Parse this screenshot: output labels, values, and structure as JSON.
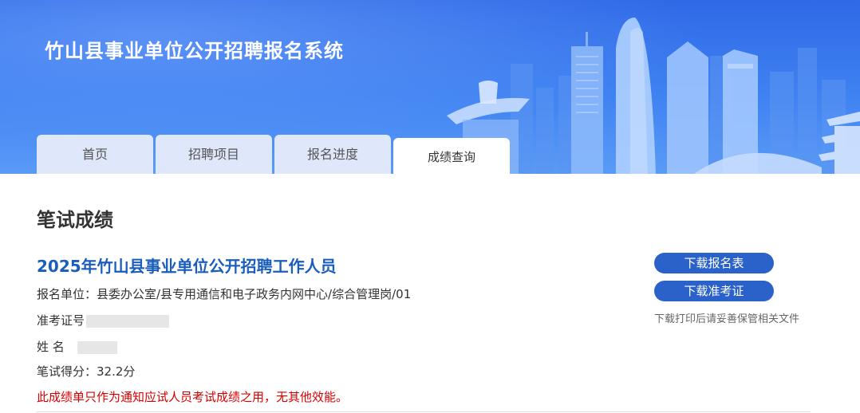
{
  "header": {
    "title": "竹山县事业单位公开招聘报名系统"
  },
  "tabs": [
    {
      "label": "首页"
    },
    {
      "label": "招聘项目"
    },
    {
      "label": "报名进度"
    },
    {
      "label": "成绩查询",
      "active": true
    }
  ],
  "main": {
    "section_title": "笔试成绩",
    "exam_title": "2025年竹山县事业单位公开招聘工作人员",
    "unit": "报名单位：县委办公室/县专用通信和电子政务内网中心/综合管理岗/01",
    "ticket_label": "准考证号",
    "name_label": "姓 名",
    "score": "笔试得分：32.2分",
    "notice": "此成绩单只作为通知应试人员考试成绩之用，无其他效能。"
  },
  "actions": {
    "download_form": "下载报名表",
    "download_ticket": "下载准考证",
    "hint": "下载打印后请妥善保管相关文件"
  },
  "colors": {
    "banner": "#3f82f2",
    "tab_inactive": "#dfe8fb",
    "title_blue": "#1a5dbd",
    "button": "#2b62c9",
    "notice_red": "#d40000"
  }
}
